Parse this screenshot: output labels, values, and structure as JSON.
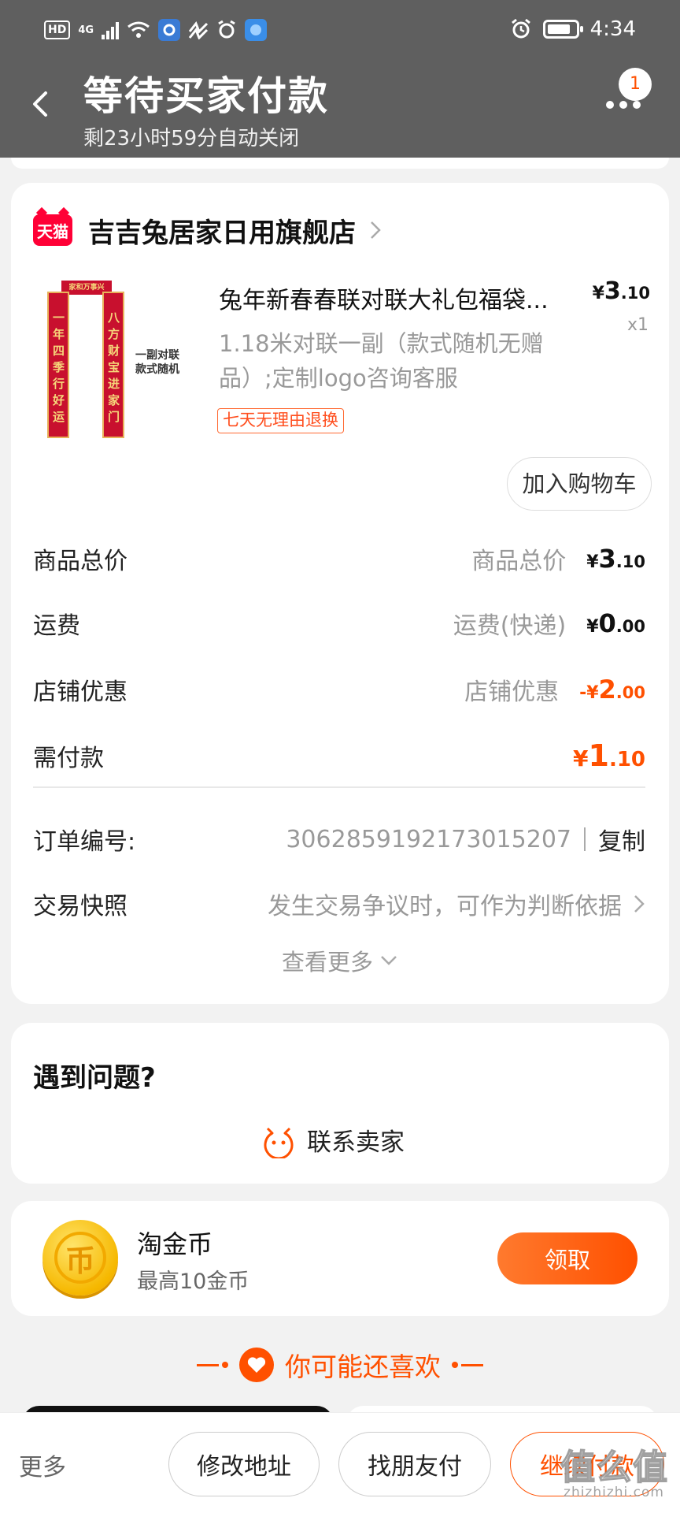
{
  "status_bar": {
    "hd": "HD",
    "network": "4G",
    "time": "4:34"
  },
  "header": {
    "title": "等待买家付款",
    "subtitle": "剩23小时59分自动关闭",
    "message_badge": "1"
  },
  "order": {
    "platform_badge": "天猫",
    "shop_name": "吉吉兔居家日用旗舰店",
    "product": {
      "title": "兔年新春春联对联大礼包福袋...",
      "price_int": "3",
      "price_dec": ".10",
      "currency": "¥",
      "quantity": "x1",
      "spec": "1.18米对联一副（款式随机无赠品）;定制logo咨询客服",
      "return_tag": "七天无理由退换",
      "image_caption": "一副对联\n款式随机",
      "image_scroll_left": "一年四季行好运",
      "image_scroll_right": "八方财宝进家门",
      "image_scroll_top": "家和万事兴"
    },
    "add_to_cart": "加入购物车",
    "summary": {
      "goods_total_label": "商品总价",
      "goods_total_sub": "商品总价",
      "goods_total_int": "3",
      "goods_total_dec": ".10",
      "shipping_label": "运费",
      "shipping_sub": "运费(快递)",
      "shipping_int": "0",
      "shipping_dec": ".00",
      "discount_label": "店铺优惠",
      "discount_sub": "店铺优惠",
      "discount_prefix": "-¥",
      "discount_int": "2",
      "discount_dec": ".00",
      "payable_label": "需付款",
      "payable_int": "1",
      "payable_dec": ".10"
    },
    "order_no_label": "订单编号:",
    "order_no": "3062859192173015207",
    "copy": "复制",
    "snapshot_label": "交易快照",
    "snapshot_text": "发生交易争议时，可作为判断依据",
    "view_more": "查看更多"
  },
  "problem": {
    "title": "遇到问题?",
    "contact": "联系卖家"
  },
  "coins": {
    "icon_char": "币",
    "title": "淘金币",
    "subtitle": "最高10金币",
    "claim": "领取"
  },
  "recommend": {
    "title": "你可能还喜欢"
  },
  "bottom_bar": {
    "more": "更多",
    "change_address": "修改地址",
    "friend_pay": "找朋友付",
    "continue_pay": "继续付款"
  },
  "watermark": {
    "main": "值么值",
    "sub": "zhizhizhi.com"
  },
  "colors": {
    "accent": "#ff5000",
    "header_bg": "#5f5f5f",
    "tmall_red": "#ff0036"
  }
}
